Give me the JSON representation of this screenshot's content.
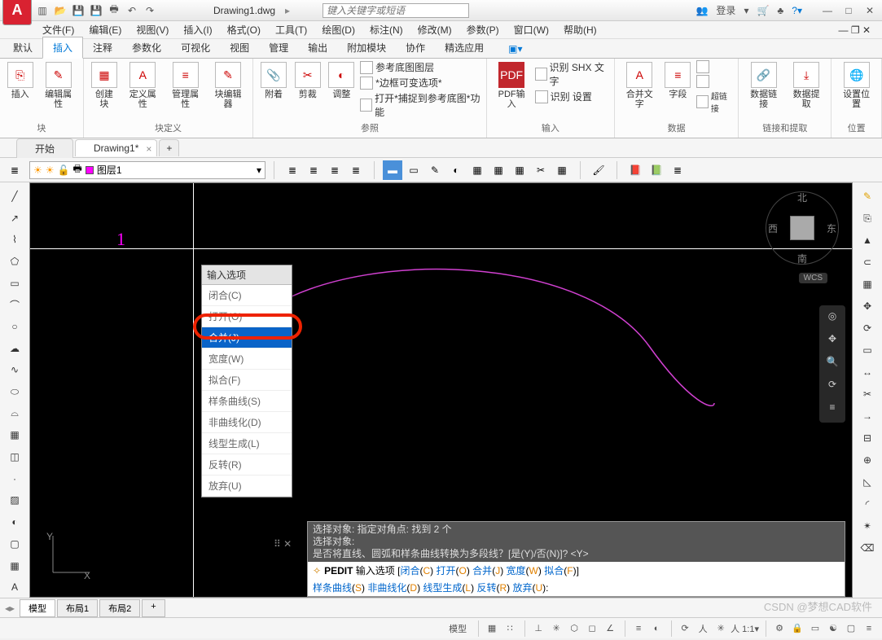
{
  "title": {
    "doc": "Drawing1.dwg",
    "search_placeholder": "键入关键字或短语",
    "login": "登录"
  },
  "menus": [
    "文件(F)",
    "编辑(E)",
    "视图(V)",
    "插入(I)",
    "格式(O)",
    "工具(T)",
    "绘图(D)",
    "标注(N)",
    "修改(M)",
    "参数(P)",
    "窗口(W)",
    "帮助(H)"
  ],
  "ribtabs": [
    "默认",
    "插入",
    "注释",
    "参数化",
    "可视化",
    "视图",
    "管理",
    "输出",
    "附加模块",
    "协作",
    "精选应用"
  ],
  "activeRibTab": "插入",
  "panels": {
    "block": {
      "title": "块",
      "btns": [
        "插入",
        "编辑属性"
      ]
    },
    "blockdef": {
      "title": "块定义",
      "btns": [
        "创建块",
        "定义属性",
        "管理属性",
        "块编辑器"
      ]
    },
    "ref": {
      "title": "参照",
      "btns": [
        "附着",
        "剪裁",
        "调整"
      ],
      "rows": [
        "参考底图图层",
        "*边框可变选项*",
        "打开*捕捉到参考底图*功能"
      ]
    },
    "input": {
      "title": "输入",
      "btn": "PDF输入",
      "rows": [
        "识别 SHX 文字",
        "识别 设置"
      ]
    },
    "data": {
      "title": "数据",
      "btns": [
        "合并文字",
        "字段"
      ]
    },
    "link": {
      "title": "链接和提取",
      "btns": [
        "数据链接",
        "数据提取"
      ]
    },
    "loc": {
      "title": "位置",
      "btn": "设置位置"
    }
  },
  "filetabs": [
    {
      "label": "开始",
      "active": false
    },
    {
      "label": "Drawing1*",
      "active": true
    }
  ],
  "layer": {
    "current": "图层1"
  },
  "ctx": {
    "header": "输入选项",
    "items": [
      "闭合(C)",
      "打开(O)",
      "合并(J)",
      "宽度(W)",
      "拟合(F)",
      "样条曲线(S)",
      "非曲线化(D)",
      "线型生成(L)",
      "反转(R)",
      "放弃(U)"
    ],
    "selected": "合并(J)"
  },
  "canvas": {
    "num": "1",
    "wcs": "WCS",
    "cube": {
      "n": "北",
      "s": "南",
      "e": "东",
      "w": "西"
    }
  },
  "cmd": {
    "hist1": "选择对象: 指定对角点: 找到 2 个",
    "hist2": "选择对象:",
    "hist3": "是否将直线、圆弧和样条曲线转换为多段线？[是(Y)/否(N)]? <Y>",
    "cmdname": "PEDIT",
    "prompt": "输入选项",
    "line1_opts": [
      [
        "闭合",
        "C"
      ],
      [
        "打开",
        "O"
      ],
      [
        "合并",
        "J"
      ],
      [
        "宽度",
        "W"
      ],
      [
        "拟合",
        "F"
      ]
    ],
    "line2_opts": [
      [
        "样条曲线",
        "S"
      ],
      [
        "非曲线化",
        "D"
      ],
      [
        "线型生成",
        "L"
      ],
      [
        "反转",
        "R"
      ],
      [
        "放弃",
        "U"
      ]
    ]
  },
  "modeltabs": [
    "模型",
    "布局1",
    "布局2"
  ],
  "status_model": "模型",
  "watermark": "CSDN @梦想CAD软件"
}
